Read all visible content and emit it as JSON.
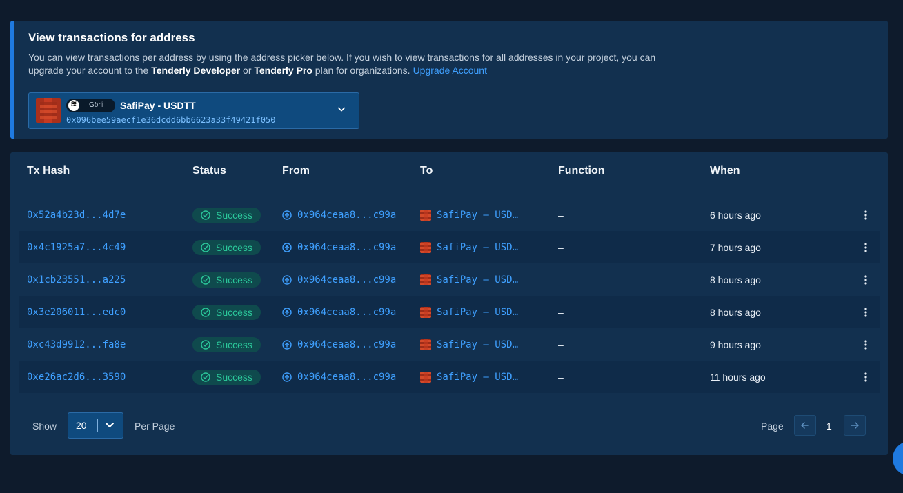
{
  "info": {
    "title": "View transactions for address",
    "desc_part1": "You can view transactions per address by using the address picker below. If you wish to view transactions for all addresses in your project, you can upgrade your account to the ",
    "desc_bold1": "Tenderly Developer",
    "desc_or": " or ",
    "desc_bold2": "Tenderly Pro",
    "desc_part2": " plan for organizations.",
    "upgrade_link": "Upgrade Account"
  },
  "picker": {
    "network": "Görli",
    "name": "SafiPay - USDTT",
    "address": "0x096bee59aecf1e36dcdd6bb6623a33f49421f050"
  },
  "table": {
    "headers": {
      "tx_hash": "Tx Hash",
      "status": "Status",
      "from": "From",
      "to": "To",
      "function": "Function",
      "when": "When"
    },
    "rows": [
      {
        "tx_hash": "0x52a4b23d...4d7e",
        "status": "Success",
        "from": "0x964ceaa8...c99a",
        "to": "SafiPay – USD…",
        "function": "–",
        "when": "6 hours ago"
      },
      {
        "tx_hash": "0x4c1925a7...4c49",
        "status": "Success",
        "from": "0x964ceaa8...c99a",
        "to": "SafiPay – USD…",
        "function": "–",
        "when": "7 hours ago"
      },
      {
        "tx_hash": "0x1cb23551...a225",
        "status": "Success",
        "from": "0x964ceaa8...c99a",
        "to": "SafiPay – USD…",
        "function": "–",
        "when": "8 hours ago"
      },
      {
        "tx_hash": "0x3e206011...edc0",
        "status": "Success",
        "from": "0x964ceaa8...c99a",
        "to": "SafiPay – USD…",
        "function": "–",
        "when": "8 hours ago"
      },
      {
        "tx_hash": "0xc43d9912...fa8e",
        "status": "Success",
        "from": "0x964ceaa8...c99a",
        "to": "SafiPay – USD…",
        "function": "–",
        "when": "9 hours ago"
      },
      {
        "tx_hash": "0xe26ac2d6...3590",
        "status": "Success",
        "from": "0x964ceaa8...c99a",
        "to": "SafiPay – USD…",
        "function": "–",
        "when": "11 hours ago"
      }
    ]
  },
  "footer": {
    "show_label": "Show",
    "page_size": "20",
    "per_page_label": "Per Page",
    "page_label": "Page",
    "current_page": "1"
  },
  "colors": {
    "background": "#0e1b2c",
    "panel": "#12304f",
    "accent": "#1f7ae0",
    "link": "#3fa0ff",
    "success": "#2bc79a"
  },
  "icons": {
    "status": "check-circle-icon",
    "from": "arrow-up-circle-icon",
    "row_menu": "kebab-menu-icon",
    "prev": "arrow-left-icon",
    "next": "arrow-right-icon"
  }
}
